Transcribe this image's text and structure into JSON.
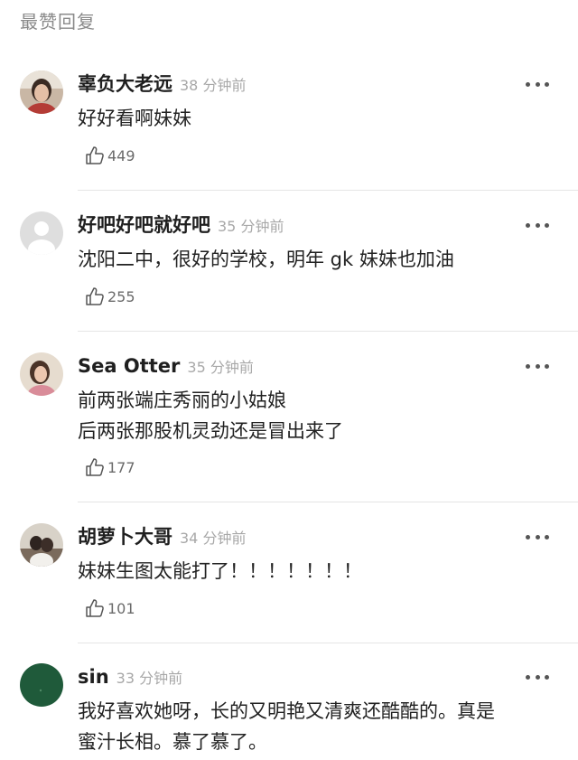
{
  "section": {
    "title": "最赞回复"
  },
  "comments": [
    {
      "username": "辜负大老远",
      "time": "38 分钟前",
      "lines": [
        "好好看啊妹妹"
      ],
      "likes": "449",
      "avatar": "photo-avatar"
    },
    {
      "username": "好吧好吧就好吧",
      "time": "35 分钟前",
      "lines": [
        "沈阳二中，很好的学校，明年 gk 妹妹也加油"
      ],
      "likes": "255",
      "avatar": "default-avatar"
    },
    {
      "username": "Sea Otter",
      "time": "35 分钟前",
      "lines": [
        "前两张端庄秀丽的小姑娘",
        "后两张那股机灵劲还是冒出来了"
      ],
      "likes": "177",
      "avatar": "photo-avatar"
    },
    {
      "username": "胡萝卜大哥",
      "time": "34 分钟前",
      "lines": [
        "妹妹生图太能打了！！！！！！！"
      ],
      "likes": "101",
      "avatar": "photo-avatar"
    },
    {
      "username": "sin",
      "time": "33 分钟前",
      "lines": [
        "我好喜欢她呀，长的又明艳又清爽还酷酷的。真是",
        "蜜汁长相。慕了慕了。"
      ],
      "likes": "",
      "avatar": "green-dot-avatar"
    }
  ],
  "icons": {
    "more": "more-dots-icon",
    "like": "thumbs-up-icon"
  },
  "colors": {
    "timestamp": "#a8a8a8",
    "like_count": "#6b6b6b",
    "section_title": "#8a8a8a",
    "green_avatar": "#1f5a3a"
  }
}
